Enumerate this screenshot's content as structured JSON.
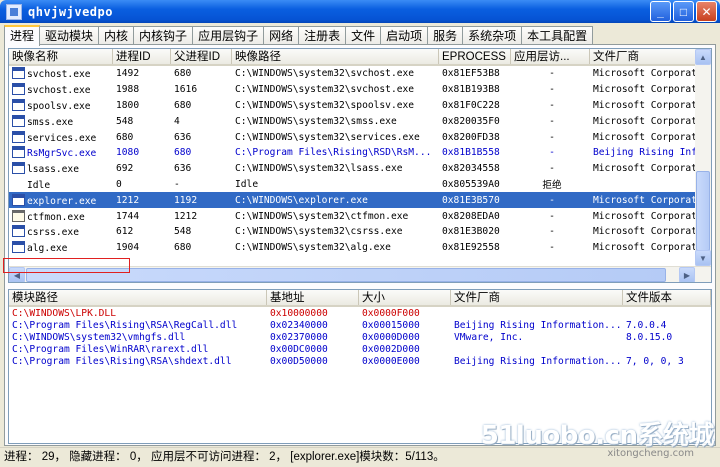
{
  "window": {
    "title": "qhvjwjvedpo"
  },
  "tabs": [
    "进程",
    "驱动模块",
    "内核",
    "内核钩子",
    "应用层钩子",
    "网络",
    "注册表",
    "文件",
    "启动项",
    "服务",
    "系统杂项",
    "本工具配置"
  ],
  "process_table": {
    "columns": [
      "映像名称",
      "进程ID",
      "父进程ID",
      "映像路径",
      "EPROCESS",
      "应用层访...",
      "文件厂商"
    ],
    "rows": [
      {
        "name": "svchost.exe",
        "pid": "1492",
        "ppid": "680",
        "path": "C:\\WINDOWS\\system32\\svchost.exe",
        "eprocess": "0x81EF53B8",
        "access": "-",
        "vendor": "Microsoft Corporation",
        "icon": "window-icon"
      },
      {
        "name": "svchost.exe",
        "pid": "1988",
        "ppid": "1616",
        "path": "C:\\WINDOWS\\system32\\svchost.exe",
        "eprocess": "0x81B193B8",
        "access": "-",
        "vendor": "Microsoft Corporation",
        "icon": "window-icon"
      },
      {
        "name": "spoolsv.exe",
        "pid": "1800",
        "ppid": "680",
        "path": "C:\\WINDOWS\\system32\\spoolsv.exe",
        "eprocess": "0x81F0C228",
        "access": "-",
        "vendor": "Microsoft Corporation",
        "icon": "window-icon"
      },
      {
        "name": "smss.exe",
        "pid": "548",
        "ppid": "4",
        "path": "C:\\WINDOWS\\system32\\smss.exe",
        "eprocess": "0x820035F0",
        "access": "-",
        "vendor": "Microsoft Corporation",
        "icon": "window-icon"
      },
      {
        "name": "services.exe",
        "pid": "680",
        "ppid": "636",
        "path": "C:\\WINDOWS\\system32\\services.exe",
        "eprocess": "0x8200FD38",
        "access": "-",
        "vendor": "Microsoft Corporation",
        "icon": "window-icon"
      },
      {
        "name": "RsMgrSvc.exe",
        "pid": "1080",
        "ppid": "680",
        "path": "C:\\Program Files\\Rising\\RSD\\RsM...",
        "eprocess": "0x81B1B558",
        "access": "-",
        "vendor": "Beijing Rising Inf...",
        "icon": "window-icon",
        "style": "blue"
      },
      {
        "name": "lsass.exe",
        "pid": "692",
        "ppid": "636",
        "path": "C:\\WINDOWS\\system32\\lsass.exe",
        "eprocess": "0x82034558",
        "access": "-",
        "vendor": "Microsoft Corporation",
        "icon": "window-icon"
      },
      {
        "name": "Idle",
        "pid": "0",
        "ppid": "-",
        "path": "Idle",
        "eprocess": "0x805539A0",
        "access": "拒绝",
        "vendor": "",
        "icon": "none"
      },
      {
        "name": "explorer.exe",
        "pid": "1212",
        "ppid": "1192",
        "path": "C:\\WINDOWS\\explorer.exe",
        "eprocess": "0x81E3B570",
        "access": "-",
        "vendor": "Microsoft Corporation",
        "icon": "explorer-icon",
        "style": "selected"
      },
      {
        "name": "ctfmon.exe",
        "pid": "1744",
        "ppid": "1212",
        "path": "C:\\WINDOWS\\system32\\ctfmon.exe",
        "eprocess": "0x8208EDA0",
        "access": "-",
        "vendor": "Microsoft Corporation",
        "icon": "ctfmon-icon"
      },
      {
        "name": "csrss.exe",
        "pid": "612",
        "ppid": "548",
        "path": "C:\\WINDOWS\\system32\\csrss.exe",
        "eprocess": "0x81E3B020",
        "access": "-",
        "vendor": "Microsoft Corporation",
        "icon": "window-icon"
      },
      {
        "name": "alg.exe",
        "pid": "1904",
        "ppid": "680",
        "path": "C:\\WINDOWS\\system32\\alg.exe",
        "eprocess": "0x81E92558",
        "access": "-",
        "vendor": "Microsoft Corporation",
        "icon": "window-icon"
      }
    ]
  },
  "module_table": {
    "columns": [
      "模块路径",
      "基地址",
      "大小",
      "文件厂商",
      "文件版本"
    ],
    "rows": [
      {
        "path": "C:\\WINDOWS\\LPK.DLL",
        "base": "0x10000000",
        "size": "0x0000F000",
        "vendor": "",
        "version": "",
        "style": "red"
      },
      {
        "path": "C:\\Program Files\\Rising\\RSA\\RegCall.dll",
        "base": "0x02340000",
        "size": "0x00015000",
        "vendor": "Beijing Rising Information...",
        "version": "7.0.0.4",
        "style": "blue"
      },
      {
        "path": "C:\\WINDOWS\\system32\\vmhgfs.dll",
        "base": "0x02370000",
        "size": "0x0000D000",
        "vendor": "VMware, Inc.",
        "version": "8.0.15.0",
        "style": "blue"
      },
      {
        "path": "C:\\Program Files\\WinRAR\\rarext.dll",
        "base": "0x00DC0000",
        "size": "0x0002D000",
        "vendor": "",
        "version": "",
        "style": "blue"
      },
      {
        "path": "C:\\Program Files\\Rising\\RSA\\shdext.dll",
        "base": "0x00D50000",
        "size": "0x0000E000",
        "vendor": "Beijing Rising Information...",
        "version": "7, 0, 0, 3",
        "style": "blue"
      }
    ]
  },
  "status_bar": "进程： 29， 隐藏进程： 0， 应用层不可访问进程： 2， [explorer.exe]模块数：5/113。",
  "watermark": {
    "main": "51luobo.cn系统城",
    "sub": "xitongcheng.com"
  },
  "colors": {
    "selected_row": "#316ac5",
    "blue_text": "#0000cc",
    "red_text": "#cc0000",
    "highlight_box": "#e02020",
    "title_bar": "#0653d4"
  }
}
